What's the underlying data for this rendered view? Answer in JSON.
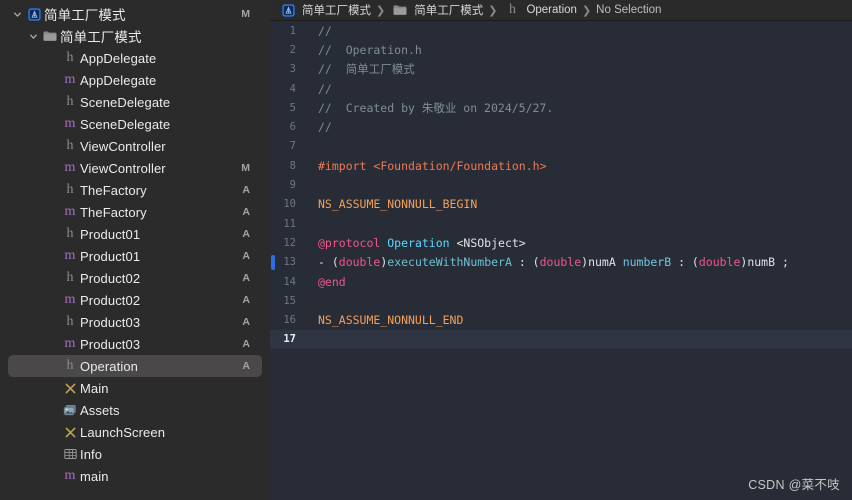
{
  "window": {
    "title": "Xcode - Operation.h",
    "colors": {
      "sidebar_bg": "#2c2b2b",
      "editor_bg": "#272c36",
      "selection_bg": "#4a4848",
      "current_line_bg": "#2f3542",
      "accent_blue": "#2f6fe0",
      "header_m": "#a472c4",
      "header_h": "#8d8b91"
    }
  },
  "breadcrumb": {
    "items": [
      {
        "icon": "xcode-project-icon",
        "label": "简单工厂模式"
      },
      {
        "icon": "folder-icon",
        "label": "简单工厂模式"
      },
      {
        "icon": "header-file-icon",
        "label": "Operation"
      },
      {
        "icon": "none",
        "label": "No Selection"
      }
    ],
    "separator": "❯"
  },
  "sidebar": {
    "items": [
      {
        "depth": 0,
        "twisty": "down",
        "icon": "xcode-project-icon",
        "label": "简单工厂模式",
        "status": "M",
        "selected": false,
        "cjk": true
      },
      {
        "depth": 1,
        "twisty": "down",
        "icon": "folder-icon",
        "label": "简单工厂模式",
        "status": "",
        "selected": false,
        "cjk": true
      },
      {
        "depth": 2,
        "twisty": "none",
        "icon": "header-file-icon",
        "label": "AppDelegate",
        "status": "",
        "selected": false
      },
      {
        "depth": 2,
        "twisty": "none",
        "icon": "objc-file-icon",
        "label": "AppDelegate",
        "status": "",
        "selected": false
      },
      {
        "depth": 2,
        "twisty": "none",
        "icon": "header-file-icon",
        "label": "SceneDelegate",
        "status": "",
        "selected": false
      },
      {
        "depth": 2,
        "twisty": "none",
        "icon": "objc-file-icon",
        "label": "SceneDelegate",
        "status": "",
        "selected": false
      },
      {
        "depth": 2,
        "twisty": "none",
        "icon": "header-file-icon",
        "label": "ViewController",
        "status": "",
        "selected": false
      },
      {
        "depth": 2,
        "twisty": "none",
        "icon": "objc-file-icon",
        "label": "ViewController",
        "status": "M",
        "selected": false
      },
      {
        "depth": 2,
        "twisty": "none",
        "icon": "header-file-icon",
        "label": "TheFactory",
        "status": "A",
        "selected": false
      },
      {
        "depth": 2,
        "twisty": "none",
        "icon": "objc-file-icon",
        "label": "TheFactory",
        "status": "A",
        "selected": false
      },
      {
        "depth": 2,
        "twisty": "none",
        "icon": "header-file-icon",
        "label": "Product01",
        "status": "A",
        "selected": false
      },
      {
        "depth": 2,
        "twisty": "none",
        "icon": "objc-file-icon",
        "label": "Product01",
        "status": "A",
        "selected": false
      },
      {
        "depth": 2,
        "twisty": "none",
        "icon": "header-file-icon",
        "label": "Product02",
        "status": "A",
        "selected": false
      },
      {
        "depth": 2,
        "twisty": "none",
        "icon": "objc-file-icon",
        "label": "Product02",
        "status": "A",
        "selected": false
      },
      {
        "depth": 2,
        "twisty": "none",
        "icon": "header-file-icon",
        "label": "Product03",
        "status": "A",
        "selected": false
      },
      {
        "depth": 2,
        "twisty": "none",
        "icon": "objc-file-icon",
        "label": "Product03",
        "status": "A",
        "selected": false
      },
      {
        "depth": 2,
        "twisty": "none",
        "icon": "header-file-icon",
        "label": "Operation",
        "status": "A",
        "selected": true
      },
      {
        "depth": 2,
        "twisty": "none",
        "icon": "storyboard-icon",
        "label": "Main",
        "status": "",
        "selected": false
      },
      {
        "depth": 2,
        "twisty": "none",
        "icon": "assets-icon",
        "label": "Assets",
        "status": "",
        "selected": false
      },
      {
        "depth": 2,
        "twisty": "none",
        "icon": "storyboard-icon",
        "label": "LaunchScreen",
        "status": "",
        "selected": false
      },
      {
        "depth": 2,
        "twisty": "none",
        "icon": "plist-icon",
        "label": "Info",
        "status": "",
        "selected": false
      },
      {
        "depth": 2,
        "twisty": "none",
        "icon": "objc-file-icon",
        "label": "main",
        "status": "",
        "selected": false
      }
    ]
  },
  "editor": {
    "filename": "Operation.h",
    "current_line": 17,
    "edit_marker_lines": [
      13
    ],
    "lines": [
      {
        "n": 1,
        "tokens": [
          {
            "t": "//",
            "c": "c-comment"
          }
        ]
      },
      {
        "n": 2,
        "tokens": [
          {
            "t": "//  Operation.h",
            "c": "c-comment"
          }
        ]
      },
      {
        "n": 3,
        "tokens": [
          {
            "t": "//  简单工厂模式",
            "c": "c-comment"
          }
        ]
      },
      {
        "n": 4,
        "tokens": [
          {
            "t": "//",
            "c": "c-comment"
          }
        ]
      },
      {
        "n": 5,
        "tokens": [
          {
            "t": "//  Created by 朱敬业 on 2024/5/27.",
            "c": "c-comment"
          }
        ]
      },
      {
        "n": 6,
        "tokens": [
          {
            "t": "//",
            "c": "c-comment"
          }
        ]
      },
      {
        "n": 7,
        "tokens": []
      },
      {
        "n": 8,
        "tokens": [
          {
            "t": "#import",
            "c": "c-pre"
          },
          {
            "t": " ",
            "c": "c-plain"
          },
          {
            "t": "<Foundation/Foundation.h>",
            "c": "c-pre"
          }
        ]
      },
      {
        "n": 9,
        "tokens": []
      },
      {
        "n": 10,
        "tokens": [
          {
            "t": "NS_ASSUME_NONNULL_BEGIN",
            "c": "c-macro"
          }
        ]
      },
      {
        "n": 11,
        "tokens": []
      },
      {
        "n": 12,
        "tokens": [
          {
            "t": "@protocol",
            "c": "c-keyword"
          },
          {
            "t": " ",
            "c": "c-plain"
          },
          {
            "t": "Operation",
            "c": "c-proto"
          },
          {
            "t": " <NSObject>",
            "c": "c-plain"
          }
        ]
      },
      {
        "n": 13,
        "tokens": [
          {
            "t": "- (",
            "c": "c-plain"
          },
          {
            "t": "double",
            "c": "c-keyword"
          },
          {
            "t": ")",
            "c": "c-plain"
          },
          {
            "t": "executeWithNumberA",
            "c": "c-method"
          },
          {
            "t": " : (",
            "c": "c-plain"
          },
          {
            "t": "double",
            "c": "c-keyword"
          },
          {
            "t": ")numA ",
            "c": "c-plain"
          },
          {
            "t": "numberB",
            "c": "c-param"
          },
          {
            "t": " : (",
            "c": "c-plain"
          },
          {
            "t": "double",
            "c": "c-keyword"
          },
          {
            "t": ")numB ;",
            "c": "c-plain"
          }
        ]
      },
      {
        "n": 14,
        "tokens": [
          {
            "t": "@end",
            "c": "c-keyword"
          }
        ]
      },
      {
        "n": 15,
        "tokens": []
      },
      {
        "n": 16,
        "tokens": [
          {
            "t": "NS_ASSUME_NONNULL_END",
            "c": "c-macro"
          }
        ]
      },
      {
        "n": 17,
        "tokens": []
      }
    ]
  },
  "watermark": {
    "text": "CSDN @菜不吱"
  }
}
